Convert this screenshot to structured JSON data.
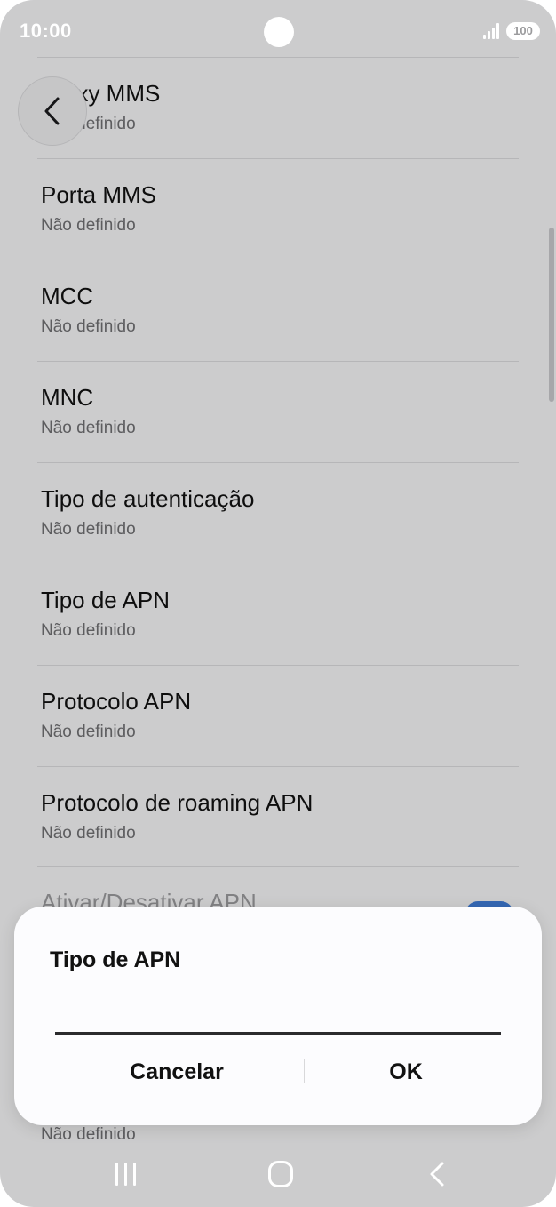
{
  "status_bar": {
    "time": "10:00",
    "battery": "100",
    "icons": [
      "signal-icon",
      "battery-icon"
    ]
  },
  "header": {
    "back_icon": "chevron-left-icon"
  },
  "settings": {
    "items": [
      {
        "title": "Proxy MMS",
        "subtitle": "Não definido"
      },
      {
        "title": "Porta MMS",
        "subtitle": "Não definido"
      },
      {
        "title": "MCC",
        "subtitle": "Não definido"
      },
      {
        "title": "MNC",
        "subtitle": "Não definido"
      },
      {
        "title": "Tipo de autenticação",
        "subtitle": "Não definido"
      },
      {
        "title": "Tipo de APN",
        "subtitle": "Não definido"
      },
      {
        "title": "Protocolo APN",
        "subtitle": "Não definido"
      },
      {
        "title": "Protocolo de roaming APN",
        "subtitle": "Não definido"
      }
    ],
    "toggle_item": {
      "title": "Ativar/Desativar APN",
      "enabled": true
    },
    "partial_subtitle": "Não definido"
  },
  "dialog": {
    "title": "Tipo de APN",
    "input_value": "",
    "cancel_label": "Cancelar",
    "ok_label": "OK"
  },
  "nav_bar": {
    "icons": [
      "recent-apps-icon",
      "home-icon",
      "back-icon"
    ]
  },
  "colors": {
    "accent": "#3e7bd6",
    "background": "#f3f3f5",
    "dialog": "#fcfcfe"
  }
}
